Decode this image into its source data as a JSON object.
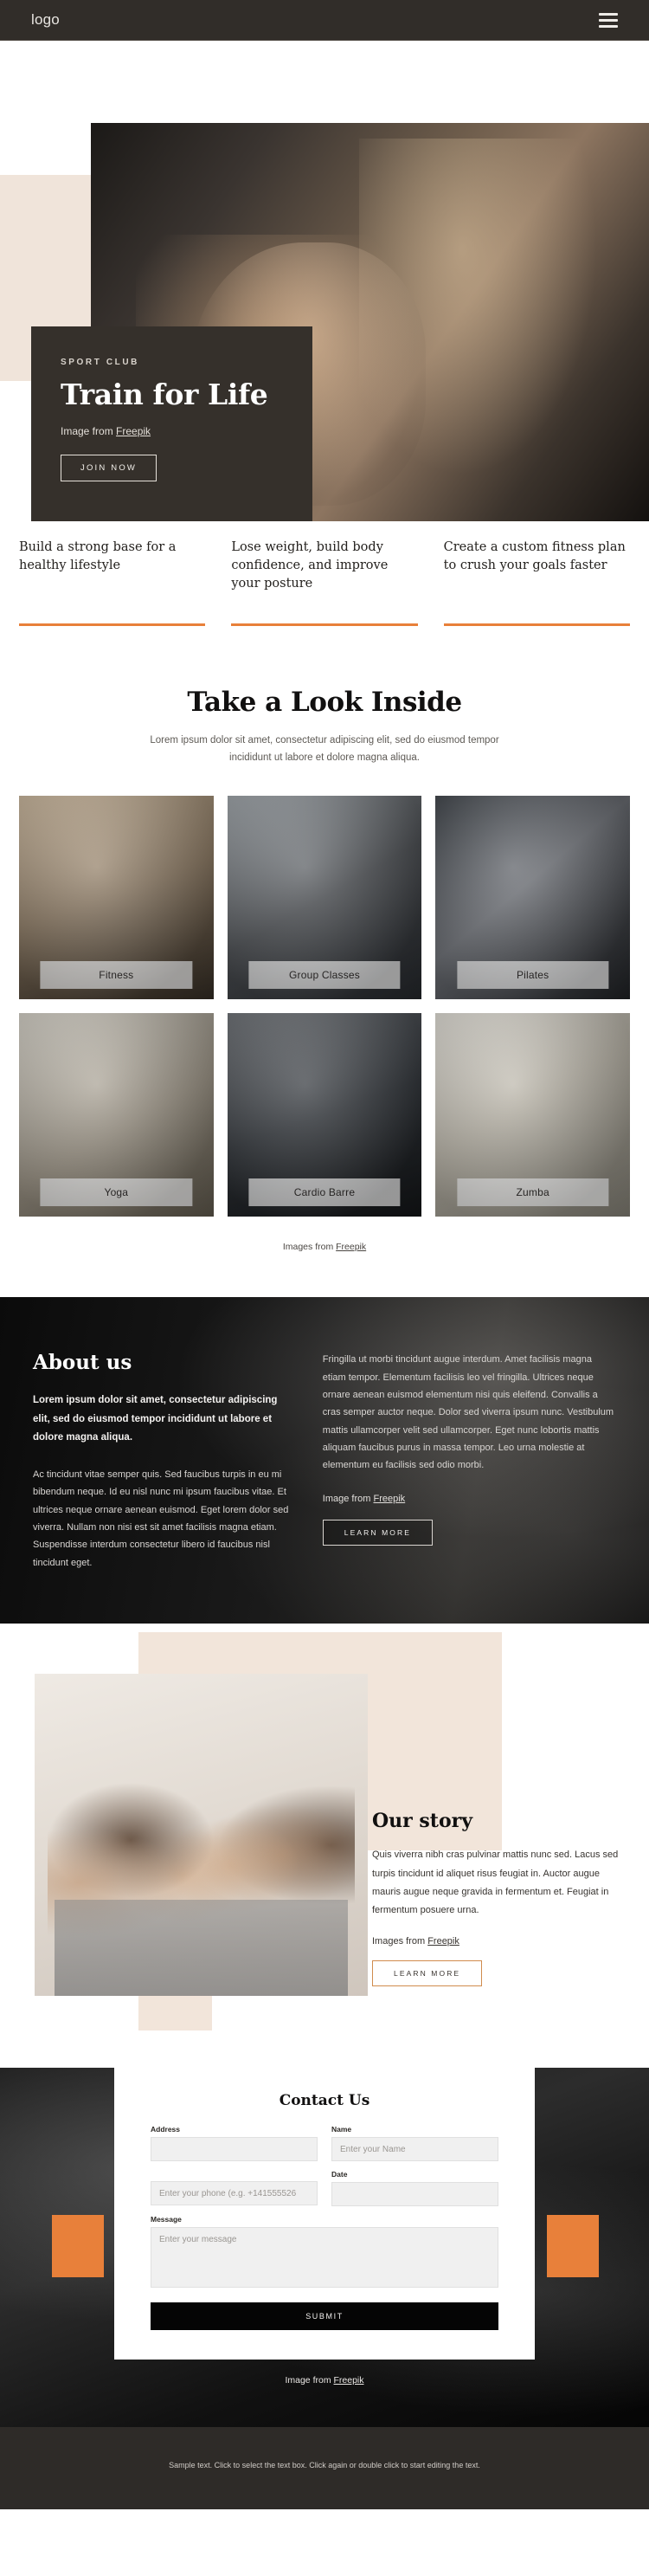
{
  "header": {
    "logo": "logo",
    "menu_icon": "hamburger-menu"
  },
  "hero": {
    "eyebrow": "SPORT CLUB",
    "title": "Train for Life",
    "credit_prefix": "Image from ",
    "credit_link": "Freepik",
    "cta": "JOIN NOW"
  },
  "features": [
    {
      "text": "Build a strong base for a healthy lifestyle"
    },
    {
      "text": "Lose weight, build body confidence, and improve your posture"
    },
    {
      "text": "Create a custom fitness plan to crush your goals faster"
    }
  ],
  "gallery": {
    "title": "Take a Look Inside",
    "subtitle": "Lorem ipsum dolor sit amet, consectetur adipiscing elit, sed do eiusmod tempor incididunt ut labore et dolore magna aliqua.",
    "items": [
      {
        "label": "Fitness"
      },
      {
        "label": "Group Classes"
      },
      {
        "label": "Pilates"
      },
      {
        "label": "Yoga"
      },
      {
        "label": "Cardio Barre"
      },
      {
        "label": "Zumba"
      }
    ],
    "credit_prefix": "Images from ",
    "credit_link": "Freepik"
  },
  "about": {
    "title": "About us",
    "lead": "Lorem ipsum dolor sit amet, consectetur adipiscing elit, sed do eiusmod tempor incididunt ut labore et dolore magna aliqua.",
    "body": "Ac tincidunt vitae semper quis. Sed faucibus turpis in eu mi bibendum neque. Id eu nisl nunc mi ipsum faucibus vitae. Et ultrices neque ornare aenean euismod. Eget lorem dolor sed viverra. Nullam non nisi est sit amet facilisis magna etiam. Suspendisse interdum consectetur libero id faucibus nisl tincidunt eget.",
    "body_right": "Fringilla ut morbi tincidunt augue interdum. Amet facilisis magna etiam tempor. Elementum facilisis leo vel fringilla. Ultrices neque ornare aenean euismod elementum nisi quis eleifend. Convallis a cras semper auctor neque. Dolor sed viverra ipsum nunc. Vestibulum mattis ullamcorper velit sed ullamcorper. Eget nunc lobortis mattis aliquam faucibus purus in massa tempor. Leo urna molestie at elementum eu facilisis sed odio morbi.",
    "credit_prefix": "Image from ",
    "credit_link": "Freepik",
    "cta": "LEARN MORE"
  },
  "story": {
    "title": "Our story",
    "body": "Quis viverra nibh cras pulvinar mattis nunc sed. Lacus sed turpis tincidunt id aliquet risus feugiat in.  Auctor augue mauris augue neque gravida in fermentum et. Feugiat in fermentum posuere urna.",
    "credit_prefix": "Images from ",
    "credit_link": "Freepik",
    "cta": "LEARN MORE"
  },
  "contact": {
    "title": "Contact Us",
    "address_label": "Address",
    "address_value": "",
    "address_placeholder": "",
    "name_label": "Name",
    "name_placeholder": "Enter your Name",
    "phone_placeholder": "Enter your phone (e.g. +141555526",
    "date_label": "Date",
    "date_placeholder": "",
    "message_label": "Message",
    "message_placeholder": "Enter your message",
    "submit": "SUBMIT",
    "credit_prefix": "Image from ",
    "credit_link": "Freepik"
  },
  "footer": {
    "text": "Sample text. Click to select the text box. Click again or double click to start editing the text."
  },
  "colors": {
    "accent_orange": "#e8803a",
    "dark": "#312d29",
    "beige": "#f2e5da"
  }
}
